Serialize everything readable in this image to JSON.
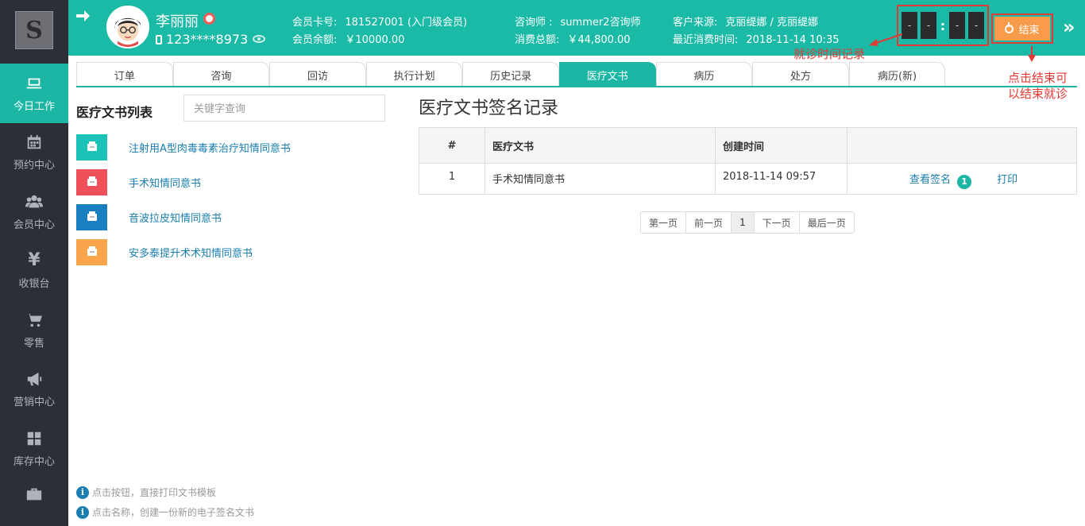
{
  "sidebar": {
    "logo_letter": "S",
    "items": [
      {
        "label": "今日工作",
        "icon": "laptop-icon",
        "active": true
      },
      {
        "label": "预约中心",
        "icon": "calendar-icon",
        "active": false
      },
      {
        "label": "会员中心",
        "icon": "users-icon",
        "active": false
      },
      {
        "label": "收银台",
        "icon": "yen-icon",
        "symbol": "¥",
        "active": false
      },
      {
        "label": "零售",
        "icon": "cart-icon",
        "active": false
      },
      {
        "label": "营销中心",
        "icon": "megaphone-icon",
        "active": false
      },
      {
        "label": "库存中心",
        "icon": "grid-icon",
        "active": false
      },
      {
        "label": "",
        "icon": "briefcase-icon",
        "active": false
      }
    ]
  },
  "header": {
    "customer_name": "李丽丽",
    "customer_phone": "123****8973",
    "card_no_label": "会员卡号:",
    "card_no_value": "181527001 (入门级会员)",
    "balance_label": "会员余额:",
    "balance_value": "￥10000.00",
    "consultant_label": "咨询师 :",
    "consultant_value": "summer2咨询师",
    "total_label": "消费总额:",
    "total_value": "￥44,800.00",
    "source_label": "客户来源:",
    "source_value": "克丽缇娜 / 克丽缇娜",
    "last_label": "最近消费时间:",
    "last_value": "2018-11-14 10:35",
    "timer": [
      "-",
      "-",
      ":",
      "-",
      "-"
    ],
    "end_button": "结束",
    "collapse": "»"
  },
  "annotations": {
    "timer_note": "就诊时间记录",
    "end_note_line1": "点击结束可",
    "end_note_line2": "以结束就诊",
    "color": "#e53935"
  },
  "tabs": [
    {
      "label": "订单",
      "active": false
    },
    {
      "label": "咨询",
      "active": false
    },
    {
      "label": "回访",
      "active": false
    },
    {
      "label": "执行计划",
      "active": false
    },
    {
      "label": "历史记录",
      "active": false
    },
    {
      "label": "医疗文书",
      "active": true
    },
    {
      "label": "病历",
      "active": false
    },
    {
      "label": "处方",
      "active": false
    },
    {
      "label": "病历(新)",
      "active": false
    }
  ],
  "doc_list": {
    "title": "医疗文书列表",
    "search_placeholder": "关键字查询",
    "items": [
      {
        "name": "注射用A型肉毒毒素治疗知情同意书",
        "color": "#1bc2b5"
      },
      {
        "name": "手术知情同意书",
        "color": "#f0505a"
      },
      {
        "name": "音波拉皮知情同意书",
        "color": "#1a7fc0"
      },
      {
        "name": "安多泰提升术术知情同意书",
        "color": "#f8a54b"
      }
    ],
    "hints": [
      "点击按钮，直接打印文书模板",
      "点击名称，创建一份新的电子签名文书"
    ]
  },
  "signatures": {
    "title": "医疗文书签名记录",
    "columns": [
      "#",
      "医疗文书",
      "创建时间",
      ""
    ],
    "rows": [
      {
        "num": "1",
        "doc": "手术知情同意书",
        "time": "2018-11-14 09:57",
        "view_label": "查看签名",
        "count": "1",
        "print_label": "打印"
      }
    ],
    "pager": [
      "第一页",
      "前一页",
      "1",
      "下一页",
      "最后一页"
    ]
  },
  "colors": {
    "accent": "#1bb7a4",
    "sidebar_bg": "#2c3036",
    "end_button": "#f89c4b",
    "link": "#1a7fb0"
  }
}
